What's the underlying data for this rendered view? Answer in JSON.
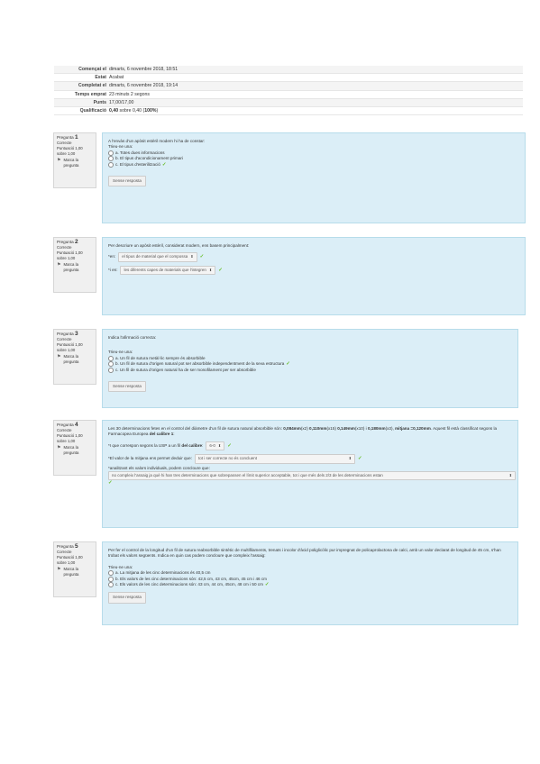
{
  "summary": [
    {
      "label": "Començat el",
      "value": "dimarts, 6 novembre 2018, 18:51"
    },
    {
      "label": "Estat",
      "value": "Acabat"
    },
    {
      "label": "Completat el",
      "value": "dimarts, 6 novembre 2018, 19:14"
    },
    {
      "label": "Temps emprat",
      "value": "23 minuts 2 segons"
    },
    {
      "label": "Punts",
      "value": "17,00/17,00"
    },
    {
      "label": "Qualificació",
      "value_b": "0,40",
      "value_mid": " sobre 0,40 (",
      "value_pct": "100%",
      "value_end": ")"
    }
  ],
  "common": {
    "pregunta": "Pregunta",
    "status": "Correcte",
    "mark_line1": "Puntuació 1,00",
    "mark_line2": "sobre 1,00",
    "flag": "Marca la pregunta",
    "choose": "Trieu-ne una:",
    "clear": "Sense resposta",
    "check": "✓"
  },
  "q1": {
    "num": "1",
    "text": "A l'envàs d'un apòsit estèril modern hi ha de constar:",
    "options": [
      "a. Totes dues informacions",
      "b. El tipus d'acondicionament primari",
      "c. El tipus d'esterilització"
    ]
  },
  "q2": {
    "num": "2",
    "text": "Per descriure un apòsit estèril, considerat modern, ens basem principalment:",
    "l1_prefix": "*en:",
    "l1_select": "el tipus de material que el compossa",
    "l2_prefix": "*i en:",
    "l2_select": "les diferents capes de materials que l'integren"
  },
  "q3": {
    "num": "3",
    "text": "Indica l'afirmació correcta:",
    "options": [
      "a. Un fil de sutura metàl·lic sempre és absorbible",
      "b. Un fil de sutura d'origen natural pot ser absorbible independentment de la seva estructura",
      "c. Un fil de sutura d'origen natural ha de ser monofilament per ser absorbible"
    ]
  },
  "q4": {
    "num": "4",
    "t1": "Les 30 determinacions fetes en el control del diàmetre d'un fil de sutura natural absorbible són: ",
    "t2": "0,084mm",
    "t3": "(x2) ",
    "t4": "0,110mm",
    "t5": "(x15) ",
    "t6": "0,149mm",
    "t7": "(x10) i ",
    "t8": "0,180mm",
    "t9": "(x3),",
    "t10": "mitjana =0,120mm",
    "t11": ". Aquest fil està classificat segons la Farmacopea Europea ",
    "t12": "del calibre 1",
    "t13": ":",
    "l1_a": "*I que correspon segons la USP a un fil ",
    "l1_b": "del calibre",
    "l1_c": ":",
    "l1_select": "6-0",
    "l2_prefix": "*El valor de la mitjana ens permet deduir que:",
    "l2_select": "tot i ser correcte  no és concluent",
    "l3_prefix": "*analitzant els valors individuals, podem concloure que:",
    "l3_select": "no compleix l'assaig ja què hi han tres determinacions que sobrepassen el límit superior acceptable, tot i que més dels 2/3 de les determinacions estan"
  },
  "q5": {
    "num": "5",
    "text": "Per fer el control de la longitud d'un fil de sutura reabsorbible sintètic de multifilaments, trenats i incolor d'àcid poliglicòlic pur impregnat de policaprolactona de calci, amb un valor declarat de longitud de 45 cm, s'han trobat els valors següents. Indica en quin cas podem concloure que compleix l'assaig:",
    "options": [
      "a. La mitjana de les cinc determinacions és 40,5 cm",
      "b. Els valors de les cinc determinacions són: 42,5 cm, 43 cm, 45cm, 45 cm i 46 cm",
      "c. Els valors de les cinc determinacions són: 43 cm, 44 cm, 45cm, 48 cm i 50 cm"
    ]
  },
  "colors": {
    "panel": "#dbeef7",
    "info": "#f0f0f0",
    "check": "#6cbf2c"
  }
}
